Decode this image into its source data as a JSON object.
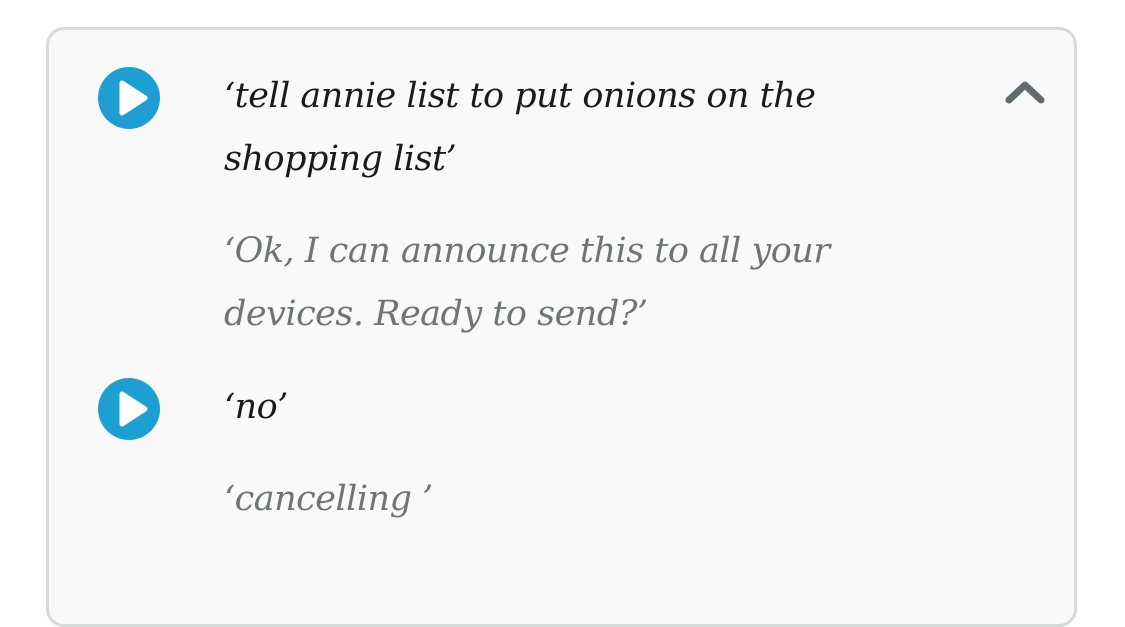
{
  "history": {
    "entries": [
      {
        "utterance": "‘tell annie list to put onions on the shopping list’",
        "utterance_line1": "‘tell annie list to put onions on the",
        "utterance_line2": "shopping list’",
        "reply_line1": "‘Ok, I can announce this to all your",
        "reply_line2": "devices. Ready to send?’"
      },
      {
        "utterance_line1": "‘no’",
        "reply_line1": "‘cancelling ’"
      }
    ],
    "play_icon": "play-icon",
    "collapse_icon": "chevron-up-icon",
    "colors": {
      "accent": "#1e9fd3",
      "utterance_text": "#1a1a1a",
      "reply_text": "#6f7475",
      "card_background": "#f9f9f9",
      "card_border": "#d7dadb",
      "chevron": "#5f6a6c"
    }
  }
}
